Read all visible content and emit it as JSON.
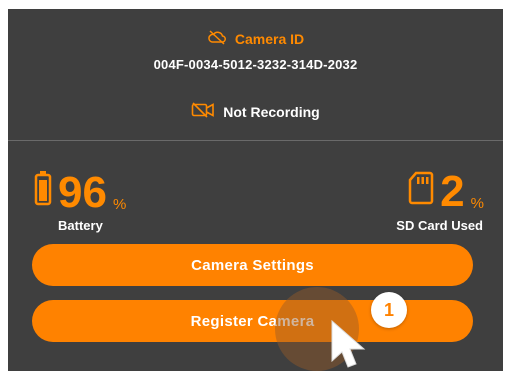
{
  "camera": {
    "id_label": "Camera ID",
    "id_value": "004F-0034-5012-3232-314D-2032",
    "recording_status": "Not Recording"
  },
  "stats": {
    "battery": {
      "value": "96",
      "unit": "%",
      "label": "Battery"
    },
    "sd_card": {
      "value": "2",
      "unit": "%",
      "label": "SD Card Used"
    }
  },
  "buttons": {
    "camera_settings": "Camera Settings",
    "register_camera": "Register Camera"
  },
  "tutorial": {
    "step_number": "1"
  },
  "colors": {
    "accent": "#ff8200",
    "panel": "#3f3f3f",
    "text": "#ffffff"
  },
  "icons": {
    "camera_id": "cloud-off-icon",
    "recording": "video-off-icon",
    "battery": "battery-icon",
    "sd_card": "sd-card-icon",
    "pointer": "cursor-pointer-icon"
  }
}
